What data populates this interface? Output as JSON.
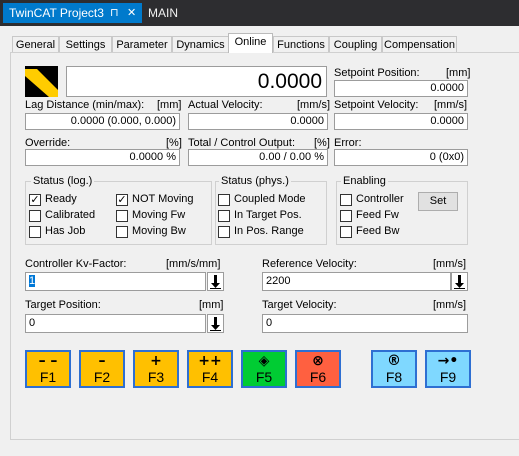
{
  "doc_tabs": {
    "active": "TwinCAT Project3",
    "pin_glyph": "⊓",
    "close_glyph": "✕",
    "other": "MAIN"
  },
  "panel_tabs": [
    "General",
    "Settings",
    "Parameter",
    "Dynamics",
    "Online",
    "Functions",
    "Coupling",
    "Compensation"
  ],
  "online": {
    "actual_position": "0.0000",
    "setpoint_position": {
      "label": "Setpoint Position:",
      "unit": "[mm]",
      "value": "0.0000"
    },
    "lag_distance": {
      "label": "Lag Distance (min/max):",
      "unit": "[mm]",
      "value": "0.0000  (0.000, 0.000)"
    },
    "actual_velocity": {
      "label": "Actual Velocity:",
      "unit": "[mm/s]",
      "value": "0.0000"
    },
    "setpoint_velocity": {
      "label": "Setpoint Velocity:",
      "unit": "[mm/s]",
      "value": "0.0000"
    },
    "override": {
      "label": "Override:",
      "unit": "[%]",
      "value": "0.0000 %"
    },
    "total_output": {
      "label": "Total / Control Output:",
      "unit": "[%]",
      "value": "0.00 /  0.00 %"
    },
    "error": {
      "label": "Error:",
      "value": "0 (0x0)"
    }
  },
  "status_log": {
    "title": "Status (log.)",
    "items": [
      {
        "label": "Ready",
        "checked": "✓"
      },
      {
        "label": "NOT Moving",
        "checked": "✓"
      },
      {
        "label": "Calibrated",
        "checked": ""
      },
      {
        "label": "Moving Fw",
        "checked": ""
      },
      {
        "label": "Has Job",
        "checked": ""
      },
      {
        "label": "Moving Bw",
        "checked": ""
      }
    ]
  },
  "status_phys": {
    "title": "Status (phys.)",
    "items": [
      {
        "label": "Coupled Mode"
      },
      {
        "label": "In Target Pos."
      },
      {
        "label": "In Pos. Range"
      }
    ]
  },
  "enabling": {
    "title": "Enabling",
    "items": [
      {
        "label": "Controller"
      },
      {
        "label": "Feed Fw"
      },
      {
        "label": "Feed Bw"
      }
    ],
    "set_label": "Set"
  },
  "inputs": {
    "kv": {
      "label": "Controller Kv-Factor:",
      "unit": "[mm/s/mm]",
      "value": "1"
    },
    "ref_velocity": {
      "label": "Reference Velocity:",
      "unit": "[mm/s]",
      "value": "2200"
    },
    "target_position": {
      "label": "Target Position:",
      "unit": "[mm]",
      "value": "0"
    },
    "target_velocity": {
      "label": "Target Velocity:",
      "unit": "[mm/s]",
      "value": "0"
    },
    "down_arrow": "🡇"
  },
  "fkeys": [
    {
      "sym": "– –",
      "num": "F1",
      "color": "#ffc000"
    },
    {
      "sym": "–",
      "num": "F2",
      "color": "#ffc000"
    },
    {
      "sym": "+",
      "num": "F3",
      "color": "#ffc000"
    },
    {
      "sym": "++",
      "num": "F4",
      "color": "#ffc000"
    },
    {
      "sym": "◈",
      "num": "F5",
      "color": "#00cc33"
    },
    {
      "sym": "⊗",
      "num": "F6",
      "color": "#ff6040"
    },
    {
      "sym": "®",
      "num": "F8",
      "color": "#7fd8ff"
    },
    {
      "sym": "→•",
      "num": "F9",
      "color": "#7fd8ff"
    }
  ]
}
